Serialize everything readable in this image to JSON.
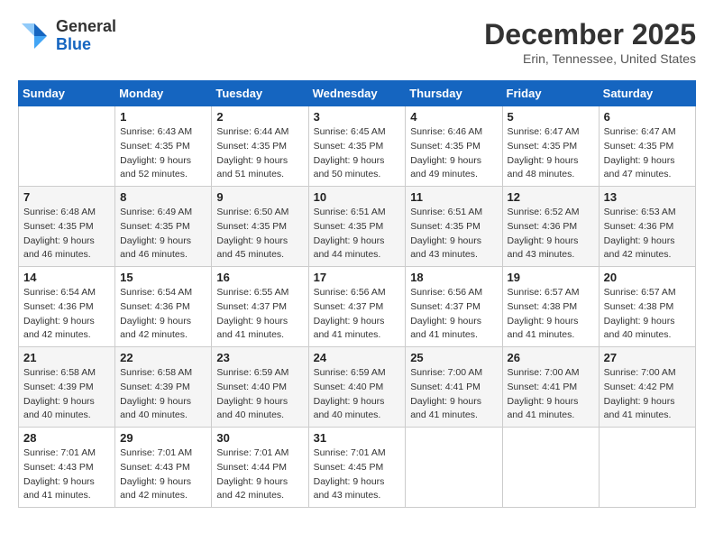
{
  "logo": {
    "general": "General",
    "blue": "Blue"
  },
  "header": {
    "month_title": "December 2025",
    "location": "Erin, Tennessee, United States"
  },
  "days_of_week": [
    "Sunday",
    "Monday",
    "Tuesday",
    "Wednesday",
    "Thursday",
    "Friday",
    "Saturday"
  ],
  "weeks": [
    [
      {
        "day": "",
        "sunrise": "",
        "sunset": "",
        "daylight": ""
      },
      {
        "day": "1",
        "sunrise": "Sunrise: 6:43 AM",
        "sunset": "Sunset: 4:35 PM",
        "daylight": "Daylight: 9 hours and 52 minutes."
      },
      {
        "day": "2",
        "sunrise": "Sunrise: 6:44 AM",
        "sunset": "Sunset: 4:35 PM",
        "daylight": "Daylight: 9 hours and 51 minutes."
      },
      {
        "day": "3",
        "sunrise": "Sunrise: 6:45 AM",
        "sunset": "Sunset: 4:35 PM",
        "daylight": "Daylight: 9 hours and 50 minutes."
      },
      {
        "day": "4",
        "sunrise": "Sunrise: 6:46 AM",
        "sunset": "Sunset: 4:35 PM",
        "daylight": "Daylight: 9 hours and 49 minutes."
      },
      {
        "day": "5",
        "sunrise": "Sunrise: 6:47 AM",
        "sunset": "Sunset: 4:35 PM",
        "daylight": "Daylight: 9 hours and 48 minutes."
      },
      {
        "day": "6",
        "sunrise": "Sunrise: 6:47 AM",
        "sunset": "Sunset: 4:35 PM",
        "daylight": "Daylight: 9 hours and 47 minutes."
      }
    ],
    [
      {
        "day": "7",
        "sunrise": "Sunrise: 6:48 AM",
        "sunset": "Sunset: 4:35 PM",
        "daylight": "Daylight: 9 hours and 46 minutes."
      },
      {
        "day": "8",
        "sunrise": "Sunrise: 6:49 AM",
        "sunset": "Sunset: 4:35 PM",
        "daylight": "Daylight: 9 hours and 46 minutes."
      },
      {
        "day": "9",
        "sunrise": "Sunrise: 6:50 AM",
        "sunset": "Sunset: 4:35 PM",
        "daylight": "Daylight: 9 hours and 45 minutes."
      },
      {
        "day": "10",
        "sunrise": "Sunrise: 6:51 AM",
        "sunset": "Sunset: 4:35 PM",
        "daylight": "Daylight: 9 hours and 44 minutes."
      },
      {
        "day": "11",
        "sunrise": "Sunrise: 6:51 AM",
        "sunset": "Sunset: 4:35 PM",
        "daylight": "Daylight: 9 hours and 43 minutes."
      },
      {
        "day": "12",
        "sunrise": "Sunrise: 6:52 AM",
        "sunset": "Sunset: 4:36 PM",
        "daylight": "Daylight: 9 hours and 43 minutes."
      },
      {
        "day": "13",
        "sunrise": "Sunrise: 6:53 AM",
        "sunset": "Sunset: 4:36 PM",
        "daylight": "Daylight: 9 hours and 42 minutes."
      }
    ],
    [
      {
        "day": "14",
        "sunrise": "Sunrise: 6:54 AM",
        "sunset": "Sunset: 4:36 PM",
        "daylight": "Daylight: 9 hours and 42 minutes."
      },
      {
        "day": "15",
        "sunrise": "Sunrise: 6:54 AM",
        "sunset": "Sunset: 4:36 PM",
        "daylight": "Daylight: 9 hours and 42 minutes."
      },
      {
        "day": "16",
        "sunrise": "Sunrise: 6:55 AM",
        "sunset": "Sunset: 4:37 PM",
        "daylight": "Daylight: 9 hours and 41 minutes."
      },
      {
        "day": "17",
        "sunrise": "Sunrise: 6:56 AM",
        "sunset": "Sunset: 4:37 PM",
        "daylight": "Daylight: 9 hours and 41 minutes."
      },
      {
        "day": "18",
        "sunrise": "Sunrise: 6:56 AM",
        "sunset": "Sunset: 4:37 PM",
        "daylight": "Daylight: 9 hours and 41 minutes."
      },
      {
        "day": "19",
        "sunrise": "Sunrise: 6:57 AM",
        "sunset": "Sunset: 4:38 PM",
        "daylight": "Daylight: 9 hours and 41 minutes."
      },
      {
        "day": "20",
        "sunrise": "Sunrise: 6:57 AM",
        "sunset": "Sunset: 4:38 PM",
        "daylight": "Daylight: 9 hours and 40 minutes."
      }
    ],
    [
      {
        "day": "21",
        "sunrise": "Sunrise: 6:58 AM",
        "sunset": "Sunset: 4:39 PM",
        "daylight": "Daylight: 9 hours and 40 minutes."
      },
      {
        "day": "22",
        "sunrise": "Sunrise: 6:58 AM",
        "sunset": "Sunset: 4:39 PM",
        "daylight": "Daylight: 9 hours and 40 minutes."
      },
      {
        "day": "23",
        "sunrise": "Sunrise: 6:59 AM",
        "sunset": "Sunset: 4:40 PM",
        "daylight": "Daylight: 9 hours and 40 minutes."
      },
      {
        "day": "24",
        "sunrise": "Sunrise: 6:59 AM",
        "sunset": "Sunset: 4:40 PM",
        "daylight": "Daylight: 9 hours and 40 minutes."
      },
      {
        "day": "25",
        "sunrise": "Sunrise: 7:00 AM",
        "sunset": "Sunset: 4:41 PM",
        "daylight": "Daylight: 9 hours and 41 minutes."
      },
      {
        "day": "26",
        "sunrise": "Sunrise: 7:00 AM",
        "sunset": "Sunset: 4:41 PM",
        "daylight": "Daylight: 9 hours and 41 minutes."
      },
      {
        "day": "27",
        "sunrise": "Sunrise: 7:00 AM",
        "sunset": "Sunset: 4:42 PM",
        "daylight": "Daylight: 9 hours and 41 minutes."
      }
    ],
    [
      {
        "day": "28",
        "sunrise": "Sunrise: 7:01 AM",
        "sunset": "Sunset: 4:43 PM",
        "daylight": "Daylight: 9 hours and 41 minutes."
      },
      {
        "day": "29",
        "sunrise": "Sunrise: 7:01 AM",
        "sunset": "Sunset: 4:43 PM",
        "daylight": "Daylight: 9 hours and 42 minutes."
      },
      {
        "day": "30",
        "sunrise": "Sunrise: 7:01 AM",
        "sunset": "Sunset: 4:44 PM",
        "daylight": "Daylight: 9 hours and 42 minutes."
      },
      {
        "day": "31",
        "sunrise": "Sunrise: 7:01 AM",
        "sunset": "Sunset: 4:45 PM",
        "daylight": "Daylight: 9 hours and 43 minutes."
      },
      {
        "day": "",
        "sunrise": "",
        "sunset": "",
        "daylight": ""
      },
      {
        "day": "",
        "sunrise": "",
        "sunset": "",
        "daylight": ""
      },
      {
        "day": "",
        "sunrise": "",
        "sunset": "",
        "daylight": ""
      }
    ]
  ]
}
